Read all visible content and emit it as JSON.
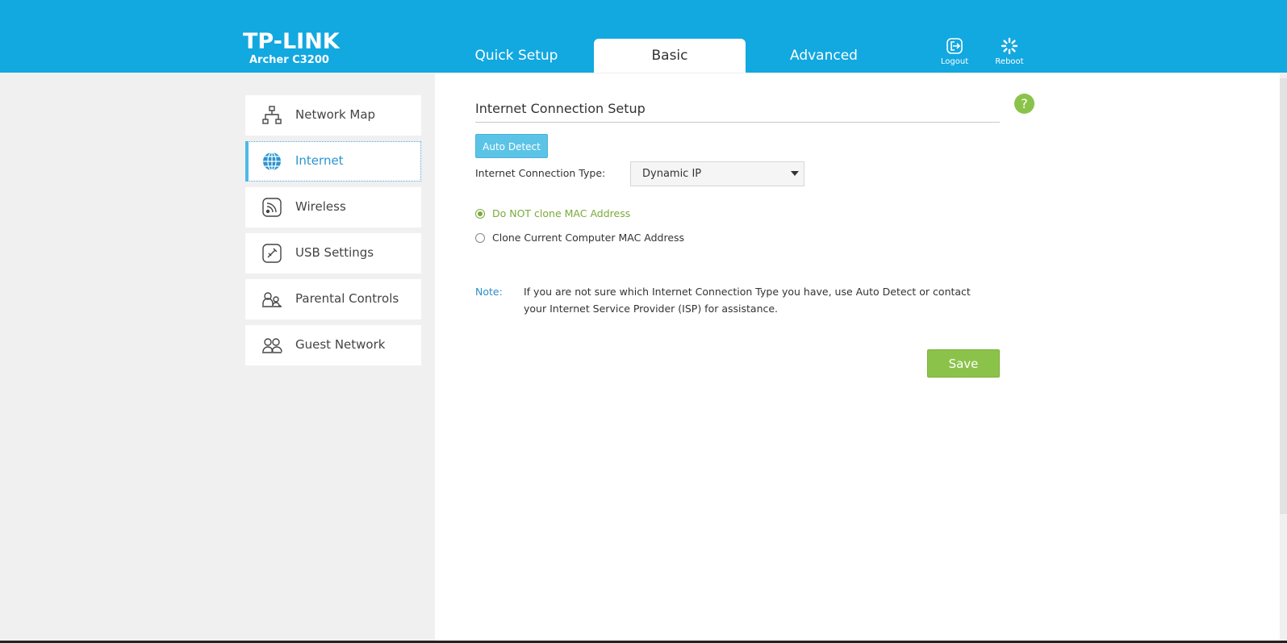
{
  "brand": {
    "logo": "TP-LINK",
    "model": "Archer C3200"
  },
  "tabs": [
    {
      "label": "Quick Setup",
      "active": false
    },
    {
      "label": "Basic",
      "active": true
    },
    {
      "label": "Advanced",
      "active": false
    }
  ],
  "header_buttons": {
    "logout": "Logout",
    "reboot": "Reboot"
  },
  "sidebar": {
    "items": [
      {
        "label": "Network Map",
        "icon": "network-map-icon"
      },
      {
        "label": "Internet",
        "icon": "globe-icon",
        "active": true
      },
      {
        "label": "Wireless",
        "icon": "wireless-icon"
      },
      {
        "label": "USB Settings",
        "icon": "usb-icon"
      },
      {
        "label": "Parental Controls",
        "icon": "parental-controls-icon"
      },
      {
        "label": "Guest Network",
        "icon": "guest-network-icon"
      }
    ]
  },
  "main": {
    "title": "Internet Connection Setup",
    "help": "?",
    "auto_detect": "Auto Detect",
    "connection_type_label": "Internet Connection Type:",
    "connection_type_value": "Dynamic IP",
    "mac_options": [
      {
        "label": "Do NOT clone MAC Address",
        "selected": true
      },
      {
        "label": "Clone Current Computer MAC Address",
        "selected": false
      }
    ],
    "note_label": "Note:",
    "note_text": "If you are not sure which Internet Connection Type you have, use Auto Detect or contact your Internet Service Provider (ISP) for assistance.",
    "save": "Save"
  },
  "colors": {
    "header": "#12a8e0",
    "accent_green": "#8bc34a",
    "accent_blue": "#5bc4e6",
    "selected_text": "#7aaa3a"
  }
}
